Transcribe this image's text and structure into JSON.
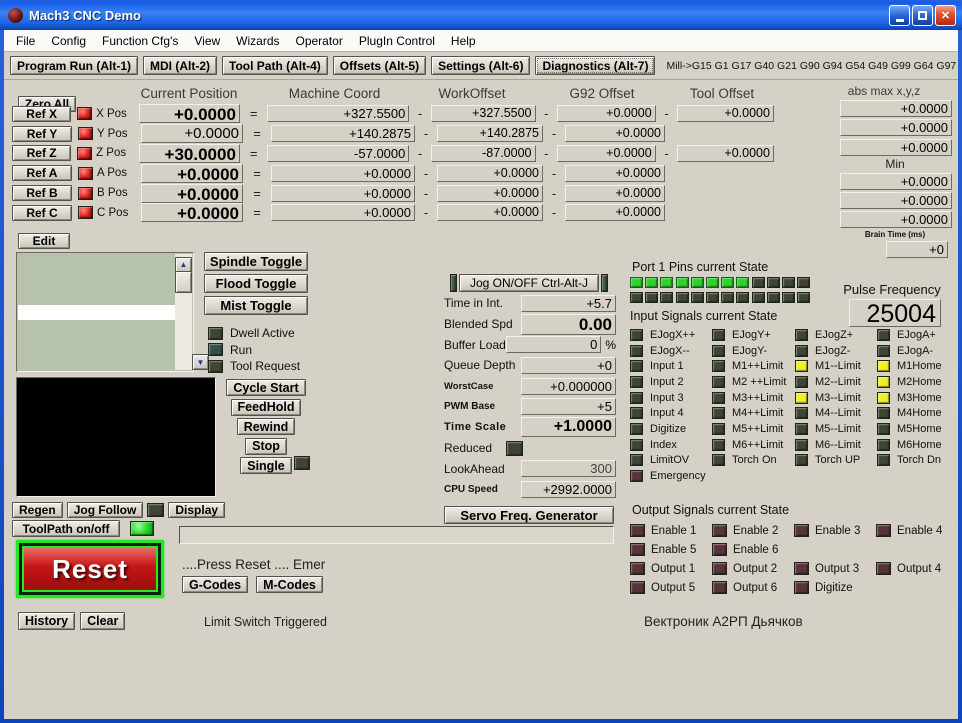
{
  "window": {
    "title": "Mach3 CNC  Demo"
  },
  "menu": {
    "items": [
      "File",
      "Config",
      "Function Cfg's",
      "View",
      "Wizards",
      "Operator",
      "PlugIn Control",
      "Help"
    ]
  },
  "tabs": {
    "items": [
      {
        "label": "Program Run (Alt-1)",
        "cls": ""
      },
      {
        "label": "MDI (Alt-2)",
        "cls": "t-bold"
      },
      {
        "label": "Tool Path (Alt-4)",
        "cls": ""
      },
      {
        "label": "Offsets (Alt-5)",
        "cls": ""
      },
      {
        "label": "Settings (Alt-6)",
        "cls": "t-bold"
      },
      {
        "label": "Diagnostics (Alt-7)",
        "cls": "t-active"
      }
    ],
    "gcode_status": "Mill->G15  G1 G17 G40 G21 G90 G94 G54 G49 G99 G64 G97"
  },
  "dro": {
    "headers": {
      "current": "Current Position",
      "machine": "Machine Coord",
      "work": "WorkOffset",
      "g92": "G92 Offset",
      "tool": "Tool Offset",
      "absmax": "abs max x,y,z"
    },
    "zero_all_label": "Zero All",
    "edit_label": "Edit",
    "rows": [
      {
        "ref": "Ref X",
        "axis": "X Pos",
        "current": "+0.0000",
        "wcls": "",
        "eq": "=",
        "machine": "+327.5500",
        "d1": "-",
        "work": "+327.5500",
        "d2": "-",
        "g92": "+0.0000",
        "d3": "-",
        "tool": "+0.0000"
      },
      {
        "ref": "Ref Y",
        "axis": "Y Pos",
        "current": "+0.0000",
        "wcls": "w-thin",
        "eq": "=",
        "machine": "+140.2875",
        "d1": "-",
        "work": "+140.2875",
        "d2": "-",
        "g92": "+0.0000"
      },
      {
        "ref": "Ref Z",
        "axis": "Z Pos",
        "current": "+30.0000",
        "wcls": "",
        "eq": "=",
        "machine": "-57.0000",
        "d1": "-",
        "work": "-87.0000",
        "d2": "-",
        "g92": "+0.0000",
        "d3": "-",
        "tool": "+0.0000"
      },
      {
        "ref": "Ref A",
        "axis": "A Pos",
        "current": "+0.0000",
        "wcls": "",
        "eq": "=",
        "machine": "+0.0000",
        "d1": "-",
        "work": "+0.0000",
        "d2": "-",
        "g92": "+0.0000"
      },
      {
        "ref": "Ref B",
        "axis": "B Pos",
        "current": "+0.0000",
        "wcls": "",
        "eq": "=",
        "machine": "+0.0000",
        "d1": "-",
        "work": "+0.0000",
        "d2": "-",
        "g92": "+0.0000"
      },
      {
        "ref": "Ref C",
        "axis": "C Pos",
        "current": "+0.0000",
        "wcls": "",
        "eq": "=",
        "machine": "+0.0000",
        "d1": "-",
        "work": "+0.0000",
        "d2": "-",
        "g92": "+0.0000"
      }
    ],
    "absmax": {
      "values": [
        "+0.0000",
        "+0.0000",
        "+0.0000"
      ],
      "min_label": "Min",
      "min_values": [
        "+0.0000",
        "+0.0000",
        "+0.0000"
      ],
      "brain_label": "Brain Time (ms)",
      "brain_value": "+0"
    }
  },
  "toggles": [
    "Spindle Toggle",
    "Flood Toggle",
    "Mist Toggle"
  ],
  "status_leds": [
    {
      "label": "Dwell Active",
      "state": "off"
    },
    {
      "label": "Run",
      "state": "run"
    },
    {
      "label": "Tool Request",
      "state": "off"
    }
  ],
  "transport": [
    "Cycle Start",
    "FeedHold",
    "Rewind",
    "Stop",
    "Single"
  ],
  "toolpath": {
    "regen": "Regen",
    "jog_follow": "Jog Follow",
    "display": "Display",
    "toolpath_onoff": "ToolPath on/off"
  },
  "reset": {
    "label": "Reset"
  },
  "footer": {
    "message": "....Press Reset .... Emer",
    "gcodes": "G-Codes",
    "mcodes": "M-Codes",
    "history": "History",
    "clear": "Clear",
    "limit": "Limit Switch Triggered",
    "vendor": "Вектроник А2РП Дьячков"
  },
  "jog": {
    "button": "Jog ON/OFF Ctrl-Alt-J",
    "servo": "Servo Freq. Generator"
  },
  "stats": [
    {
      "label": "Time in Int.",
      "value": "+5.7"
    },
    {
      "label": "Blended Spd",
      "value": "0.00",
      "vcls": "v-big"
    },
    {
      "label": "Buffer Load",
      "value": "0",
      "suffix": "%"
    },
    {
      "label": "Queue Depth",
      "value": "+0"
    },
    {
      "label": "WorstCase",
      "value": "+0.000000",
      "lcls": "l-sm"
    },
    {
      "label": "PWM Base",
      "value": "+5",
      "lcls": "l-sm2"
    },
    {
      "label": "Time Scale",
      "value": "+1.0000",
      "vcls": "v-big2",
      "lcls": "l-sp"
    },
    {
      "label": "Reduced",
      "led": "off"
    },
    {
      "label": "LookAhead",
      "value": "300",
      "vcls": "v-gray"
    },
    {
      "label": "CPU Speed",
      "value": "+2992.0000",
      "lcls": "l-sm2"
    }
  ],
  "port1": {
    "title": "Port 1 Pins current State",
    "row1": [
      "on",
      "on",
      "on",
      "on",
      "on",
      "on",
      "on",
      "on",
      "off",
      "off",
      "off",
      "off"
    ],
    "row2": [
      "off",
      "off",
      "off",
      "off",
      "off",
      "off",
      "off",
      "off",
      "off",
      "off",
      "off",
      "off"
    ],
    "input_title": "Input Signals current State"
  },
  "pulse": {
    "label": "Pulse Frequency",
    "value": "25004"
  },
  "inputs": {
    "columns": [
      {
        "items": [
          {
            "label": "EJogX++",
            "state": "off"
          },
          {
            "label": "EJogX--",
            "state": "off"
          },
          {
            "label": "Input 1",
            "state": "off"
          },
          {
            "label": "Input 2",
            "state": "off"
          },
          {
            "label": "Input 3",
            "state": "off"
          },
          {
            "label": "Input 4",
            "state": "off"
          },
          {
            "label": "Digitize",
            "state": "off"
          },
          {
            "label": "Index",
            "state": "off"
          },
          {
            "label": "LimitOV",
            "state": "off"
          },
          {
            "label": "Emergency",
            "state": "maroon"
          }
        ]
      },
      {
        "items": [
          {
            "label": "EJogY+",
            "state": "off"
          },
          {
            "label": "EJogY-",
            "state": "off"
          },
          {
            "label": "M1++Limit",
            "state": "off"
          },
          {
            "label": "M2 ++Limit",
            "state": "off"
          },
          {
            "label": "M3++Limit",
            "state": "off"
          },
          {
            "label": "M4++Limit",
            "state": "off"
          },
          {
            "label": "M5++Limit",
            "state": "off"
          },
          {
            "label": "M6++Limit",
            "state": "off"
          },
          {
            "label": "Torch On",
            "state": "off"
          }
        ]
      },
      {
        "items": [
          {
            "label": "EJogZ+",
            "state": "off"
          },
          {
            "label": "EJogZ-",
            "state": "off"
          },
          {
            "label": "M1--Limit",
            "state": "yellow"
          },
          {
            "label": "M2--Limit",
            "state": "off"
          },
          {
            "label": "M3--Limit",
            "state": "yellow"
          },
          {
            "label": "M4--Limit",
            "state": "off"
          },
          {
            "label": "M5--Limit",
            "state": "off"
          },
          {
            "label": "M6--Limit",
            "state": "off"
          },
          {
            "label": "Torch UP",
            "state": "off"
          }
        ]
      },
      {
        "items": [
          {
            "label": "EJogA+",
            "state": "off"
          },
          {
            "label": "EJogA-",
            "state": "off"
          },
          {
            "label": "M1Home",
            "state": "yellow"
          },
          {
            "label": "M2Home",
            "state": "yellow"
          },
          {
            "label": "M3Home",
            "state": "yellow"
          },
          {
            "label": "M4Home",
            "state": "off"
          },
          {
            "label": "M5Home",
            "state": "off"
          },
          {
            "label": "M6Home",
            "state": "off"
          },
          {
            "label": "Torch Dn",
            "state": "off"
          }
        ]
      }
    ]
  },
  "outputs": {
    "title": "Output Signals current State",
    "rows": [
      [
        {
          "label": "Enable 1",
          "state": "maroon"
        },
        {
          "label": "Enable 2",
          "state": "maroon"
        },
        {
          "label": "Enable 3",
          "state": "maroon"
        },
        {
          "label": "Enable 4",
          "state": "maroon"
        }
      ],
      [
        {
          "label": "Enable 5",
          "state": "maroon"
        },
        {
          "label": "Enable 6",
          "state": "maroon"
        }
      ],
      [
        {
          "label": "Output 1",
          "state": "maroon"
        },
        {
          "label": "Output 2",
          "state": "maroon"
        },
        {
          "label": "Output 3",
          "state": "maroon"
        },
        {
          "label": "Output 4",
          "state": "maroon"
        }
      ],
      [
        {
          "label": "Output 5",
          "state": "maroon"
        },
        {
          "label": "Output 6",
          "state": "maroon"
        },
        {
          "label": "Digitize",
          "state": "maroon"
        }
      ]
    ]
  },
  "colors": {
    "titlebar_blue": "#1b5fd8",
    "client_gray": "#d5d1c7",
    "led_green": "#2ed12e",
    "led_red": "#d21414",
    "led_yellow": "#f0f02a",
    "led_dark": "#3e4633",
    "led_maroon": "#57333b",
    "reset_red": "#c41414",
    "reset_ring_green": "#25e525",
    "listbox_green": "#b7c2ad"
  }
}
